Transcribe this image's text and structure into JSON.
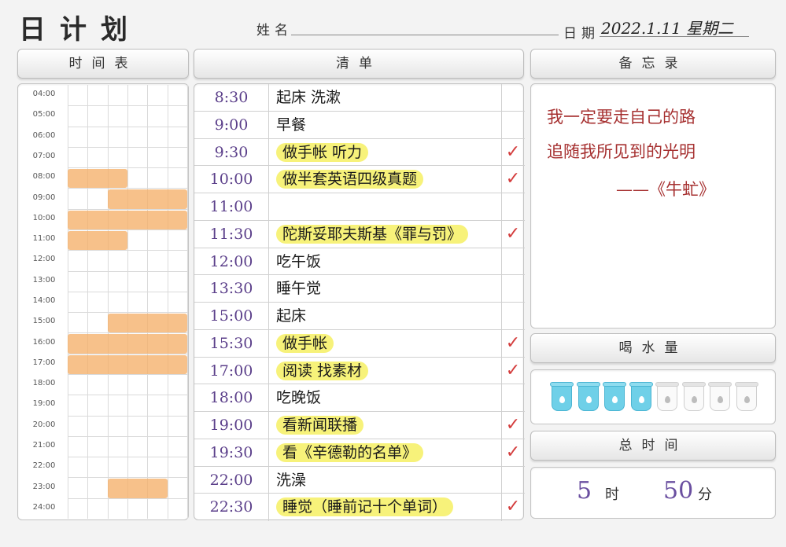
{
  "header": {
    "title": "日计划",
    "name_label": "姓名",
    "date_label": "日期",
    "date_value": "2022.1.11  星期二"
  },
  "sections": {
    "schedule": "时间表",
    "checklist": "清单",
    "memo": "备忘录",
    "water": "喝水量",
    "total_time": "总时间"
  },
  "schedule": {
    "times": [
      "04:00",
      "05:00",
      "06:00",
      "07:00",
      "08:00",
      "09:00",
      "10:00",
      "11:00",
      "12:00",
      "13:00",
      "14:00",
      "15:00",
      "16:00",
      "17:00",
      "18:00",
      "19:00",
      "20:00",
      "21:00",
      "22:00",
      "23:00",
      "24:00"
    ],
    "highlight_color": "#f5af69",
    "blocks": [
      {
        "hour": "08:00",
        "from_col": 0,
        "to_col": 3
      },
      {
        "hour": "09:00",
        "from_col": 2,
        "to_col": 6
      },
      {
        "hour": "10:00",
        "from_col": 0,
        "to_col": 6
      },
      {
        "hour": "11:00",
        "from_col": 0,
        "to_col": 3
      },
      {
        "hour": "15:00",
        "from_col": 2,
        "to_col": 6
      },
      {
        "hour": "16:00",
        "from_col": 0,
        "to_col": 6
      },
      {
        "hour": "17:00",
        "from_col": 0,
        "to_col": 6
      },
      {
        "hour": "23:00",
        "from_col": 2,
        "to_col": 5
      }
    ]
  },
  "checklist": [
    {
      "time": "8:30",
      "task": "起床 洗漱",
      "highlighted": false,
      "done": false
    },
    {
      "time": "9:00",
      "task": "早餐",
      "highlighted": false,
      "done": false
    },
    {
      "time": "9:30",
      "task": "做手帐 听力",
      "highlighted": true,
      "done": true
    },
    {
      "time": "10:00",
      "task": "做半套英语四级真题",
      "highlighted": true,
      "done": true
    },
    {
      "time": "11:00",
      "task": "",
      "highlighted": false,
      "done": false
    },
    {
      "time": "11:30",
      "task": "陀斯妥耶夫斯基《罪与罚》",
      "highlighted": true,
      "done": true
    },
    {
      "time": "12:00",
      "task": "吃午饭",
      "highlighted": false,
      "done": false
    },
    {
      "time": "13:30",
      "task": "睡午觉",
      "highlighted": false,
      "done": false
    },
    {
      "time": "15:00",
      "task": "起床",
      "highlighted": false,
      "done": false
    },
    {
      "time": "15:30",
      "task": "做手帐",
      "highlighted": true,
      "done": true
    },
    {
      "time": "17:00",
      "task": "阅读 找素材",
      "highlighted": true,
      "done": true
    },
    {
      "time": "18:00",
      "task": "吃晚饭",
      "highlighted": false,
      "done": false
    },
    {
      "time": "19:00",
      "task": "看新闻联播",
      "highlighted": true,
      "done": true
    },
    {
      "time": "19:30",
      "task": "看《辛德勒的名单》",
      "highlighted": true,
      "done": true
    },
    {
      "time": "22:00",
      "task": "洗澡",
      "highlighted": false,
      "done": false
    },
    {
      "time": "22:30",
      "task": "睡觉（睡前记十个单词）",
      "highlighted": true,
      "done": true
    }
  ],
  "check_mark": "✓",
  "memo": {
    "lines": [
      "我一定要走自己的路",
      "追随我所见到的光明",
      "——《牛虻》"
    ],
    "color": "#a63030"
  },
  "water": {
    "total_cups": 8,
    "filled_cups": 4,
    "fill_color": "#6fd0e8"
  },
  "total_time": {
    "hours": "5",
    "hours_unit": "时",
    "minutes": "50",
    "minutes_unit": "分"
  }
}
